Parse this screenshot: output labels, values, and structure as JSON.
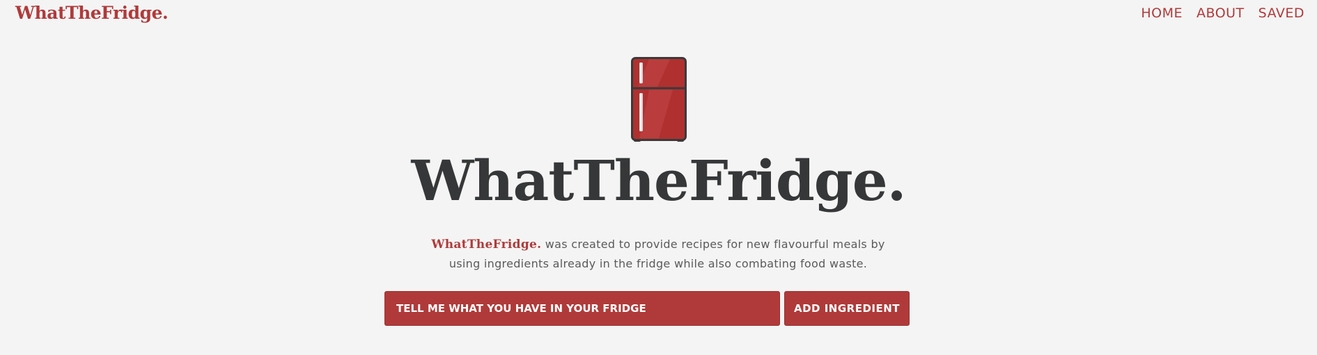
{
  "header": {
    "logo": "WhatTheFridge.",
    "nav": {
      "home": "HOME",
      "about": "ABOUT",
      "saved": "SAVED"
    }
  },
  "hero": {
    "icon": "fridge-icon",
    "title": "WhatTheFridge.",
    "description_brand": "WhatTheFridge.",
    "description_line1": "was created to provide recipes for new flavourful meals by",
    "description_line2": "using ingredients already in the fridge while also combating food waste."
  },
  "search": {
    "placeholder": "TELL ME WHAT YOU HAVE IN YOUR FRIDGE",
    "add_label": "ADD INGREDIENT"
  },
  "colors": {
    "accent": "#b03a3a",
    "title": "#363738",
    "background": "#f4f4f4"
  }
}
